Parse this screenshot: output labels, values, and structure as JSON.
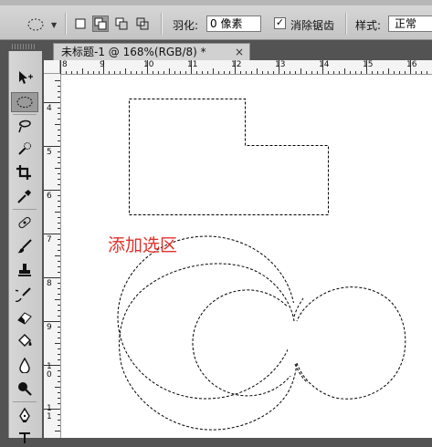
{
  "options_bar": {
    "feather_label": "羽化:",
    "feather_value": "0 像素",
    "antialias_label": "消除锯齿",
    "antialias_checked": "✓",
    "style_label": "样式:",
    "style_value": "正常"
  },
  "document": {
    "tab_title": "未标题-1 @ 168%(RGB/8) *",
    "close_glyph": "×"
  },
  "ruler": {
    "horizontal": [
      "8",
      "9",
      "10",
      "11",
      "12",
      "13",
      "14",
      "15",
      "16"
    ],
    "vertical": [
      "4",
      "5",
      "6",
      "7",
      "8",
      "9",
      "1 0",
      "1 1"
    ]
  },
  "canvas": {
    "caption": "添加选区"
  },
  "tools": [
    "move-tool-icon",
    "elliptical-marquee-icon",
    "lasso-icon",
    "quick-selection-icon",
    "crop-icon",
    "eyedropper-icon",
    "spot-healing-icon",
    "brush-icon",
    "clone-stamp-icon",
    "history-brush-icon",
    "eraser-icon",
    "paint-bucket-icon",
    "blur-icon",
    "dodge-icon",
    "pen-icon",
    "type-icon"
  ],
  "colors": {
    "caption": "#e0302a",
    "panel": "#535353",
    "toolbar": "#d0d0d0"
  }
}
